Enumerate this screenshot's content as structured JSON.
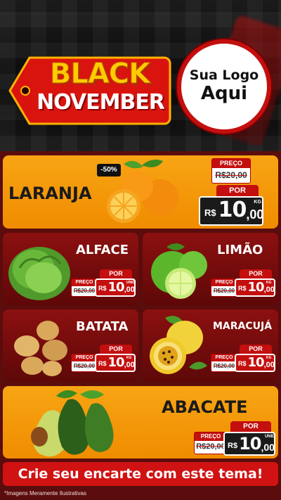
{
  "header": {
    "tag_line1": "BLACK",
    "tag_line2": "NOVEMBER",
    "logo_line1": "Sua Logo",
    "logo_line2": "Aqui"
  },
  "products": {
    "laranja": {
      "name": "LARANJA",
      "discount": "-50%",
      "old_label": "PREÇO",
      "old_price": "R$20,00",
      "por": "POR",
      "currency": "R$",
      "price_int": "10",
      "price_dec": ",00",
      "unit": "KG"
    },
    "alface": {
      "name": "ALFACE",
      "old_label": "PREÇO",
      "old_price": "R$20,00",
      "por": "POR",
      "currency": "R$",
      "price_int": "10",
      "price_dec": ",00",
      "unit": "UNID"
    },
    "limao": {
      "name": "LIMÃO",
      "old_label": "PREÇO",
      "old_price": "R$20,00",
      "por": "POR",
      "currency": "R$",
      "price_int": "10",
      "price_dec": ",00",
      "unit": "KG"
    },
    "batata": {
      "name": "BATATA",
      "old_label": "PREÇO",
      "old_price": "R$20,00",
      "por": "POR",
      "currency": "R$",
      "price_int": "10",
      "price_dec": ",00",
      "unit": "KG"
    },
    "maracuja": {
      "name": "MARACUJÁ",
      "old_label": "PREÇO",
      "old_price": "R$20,00",
      "por": "POR",
      "currency": "R$",
      "price_int": "10",
      "price_dec": ",00",
      "unit": "KG"
    },
    "abacate": {
      "name": "ABACATE",
      "old_label": "PREÇO",
      "old_price": "R$20,00",
      "por": "POR",
      "currency": "R$",
      "price_int": "10",
      "price_dec": ",00",
      "unit": "UNID"
    }
  },
  "footer": {
    "cta": "Crie seu encarte com este tema!",
    "disclaimer": "*Imagens Meramente Ilustrativas"
  },
  "colors": {
    "accent_red": "#c40f0f",
    "accent_orange": "#f7a514",
    "dark_red": "#5e0808",
    "black": "#111111"
  }
}
